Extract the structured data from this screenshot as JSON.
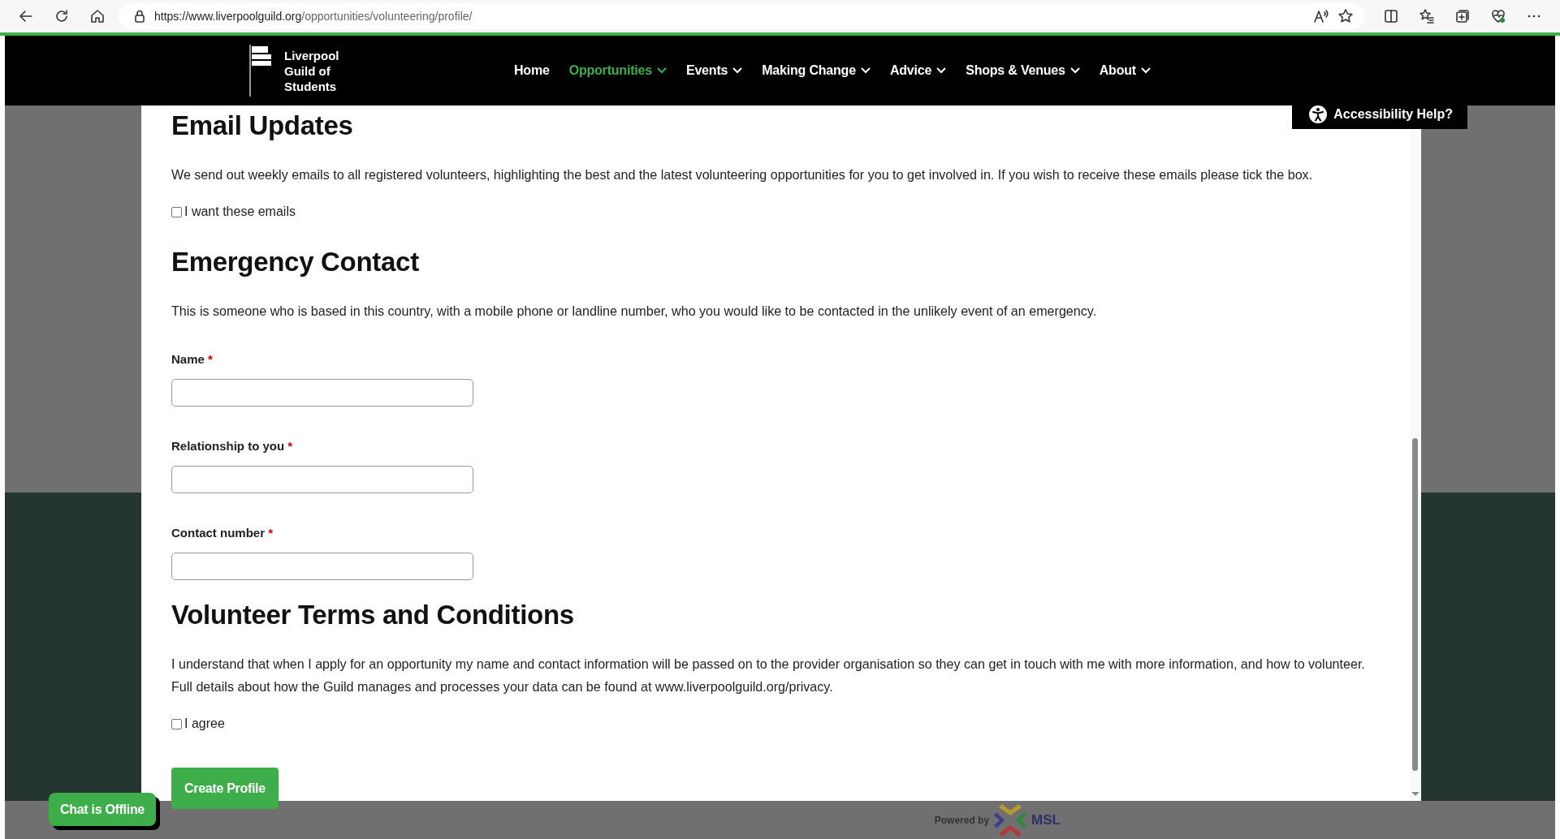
{
  "browser": {
    "url_host": "https://www.liverpoolguild.org",
    "url_path": "/opportunities/volunteering/profile/"
  },
  "site": {
    "logo_lines": [
      "Liverpool",
      "Guild of",
      "Students"
    ],
    "nav": [
      {
        "label": "Home",
        "selected": false,
        "dropdown": false
      },
      {
        "label": "Opportunities",
        "selected": true,
        "dropdown": true
      },
      {
        "label": "Events",
        "selected": false,
        "dropdown": true
      },
      {
        "label": "Making Change",
        "selected": false,
        "dropdown": true
      },
      {
        "label": "Advice",
        "selected": false,
        "dropdown": true
      },
      {
        "label": "Shops & Venues",
        "selected": false,
        "dropdown": true
      },
      {
        "label": "About",
        "selected": false,
        "dropdown": true
      }
    ],
    "accessibility_button": "Accessibility Help?"
  },
  "form": {
    "items": [
      {
        "kind": "heading",
        "text": "Email Updates"
      },
      {
        "kind": "paragraph",
        "text": "We send out weekly emails to all registered volunteers, highlighting the best and the latest volunteering opportunities for you to get involved in. If you wish to receive these emails please tick the box."
      },
      {
        "kind": "checkbox",
        "label": "I want these emails",
        "checked": false
      },
      {
        "kind": "heading",
        "text": "Emergency Contact"
      },
      {
        "kind": "paragraph",
        "text": "This is someone who is based in this country, with a mobile phone or landline number, who you would like to be contacted in the unlikely event of an emergency."
      },
      {
        "kind": "field",
        "label": "Name",
        "required_mark": "*"
      },
      {
        "kind": "field",
        "label": "Relationship to you",
        "required_mark": "*"
      },
      {
        "kind": "field",
        "label": "Contact number",
        "required_mark": "*"
      },
      {
        "kind": "heading",
        "text": "Volunteer Terms and Conditions"
      },
      {
        "kind": "paragraph",
        "text": "I understand that when I apply for an opportunity my name and contact information will be passed on to the provider organisation so they can get in touch with me with more information, and how to volunteer. Full details about how the Guild manages and processes your data can be found at www.liverpoolguild.org/privacy."
      },
      {
        "kind": "checkbox",
        "label": "I agree",
        "checked": false
      },
      {
        "kind": "button",
        "label": "Create Profile"
      }
    ]
  },
  "chat_button": "Chat is Offline",
  "footer": {
    "powered_by": "Powered by",
    "brand": "MSL"
  }
}
